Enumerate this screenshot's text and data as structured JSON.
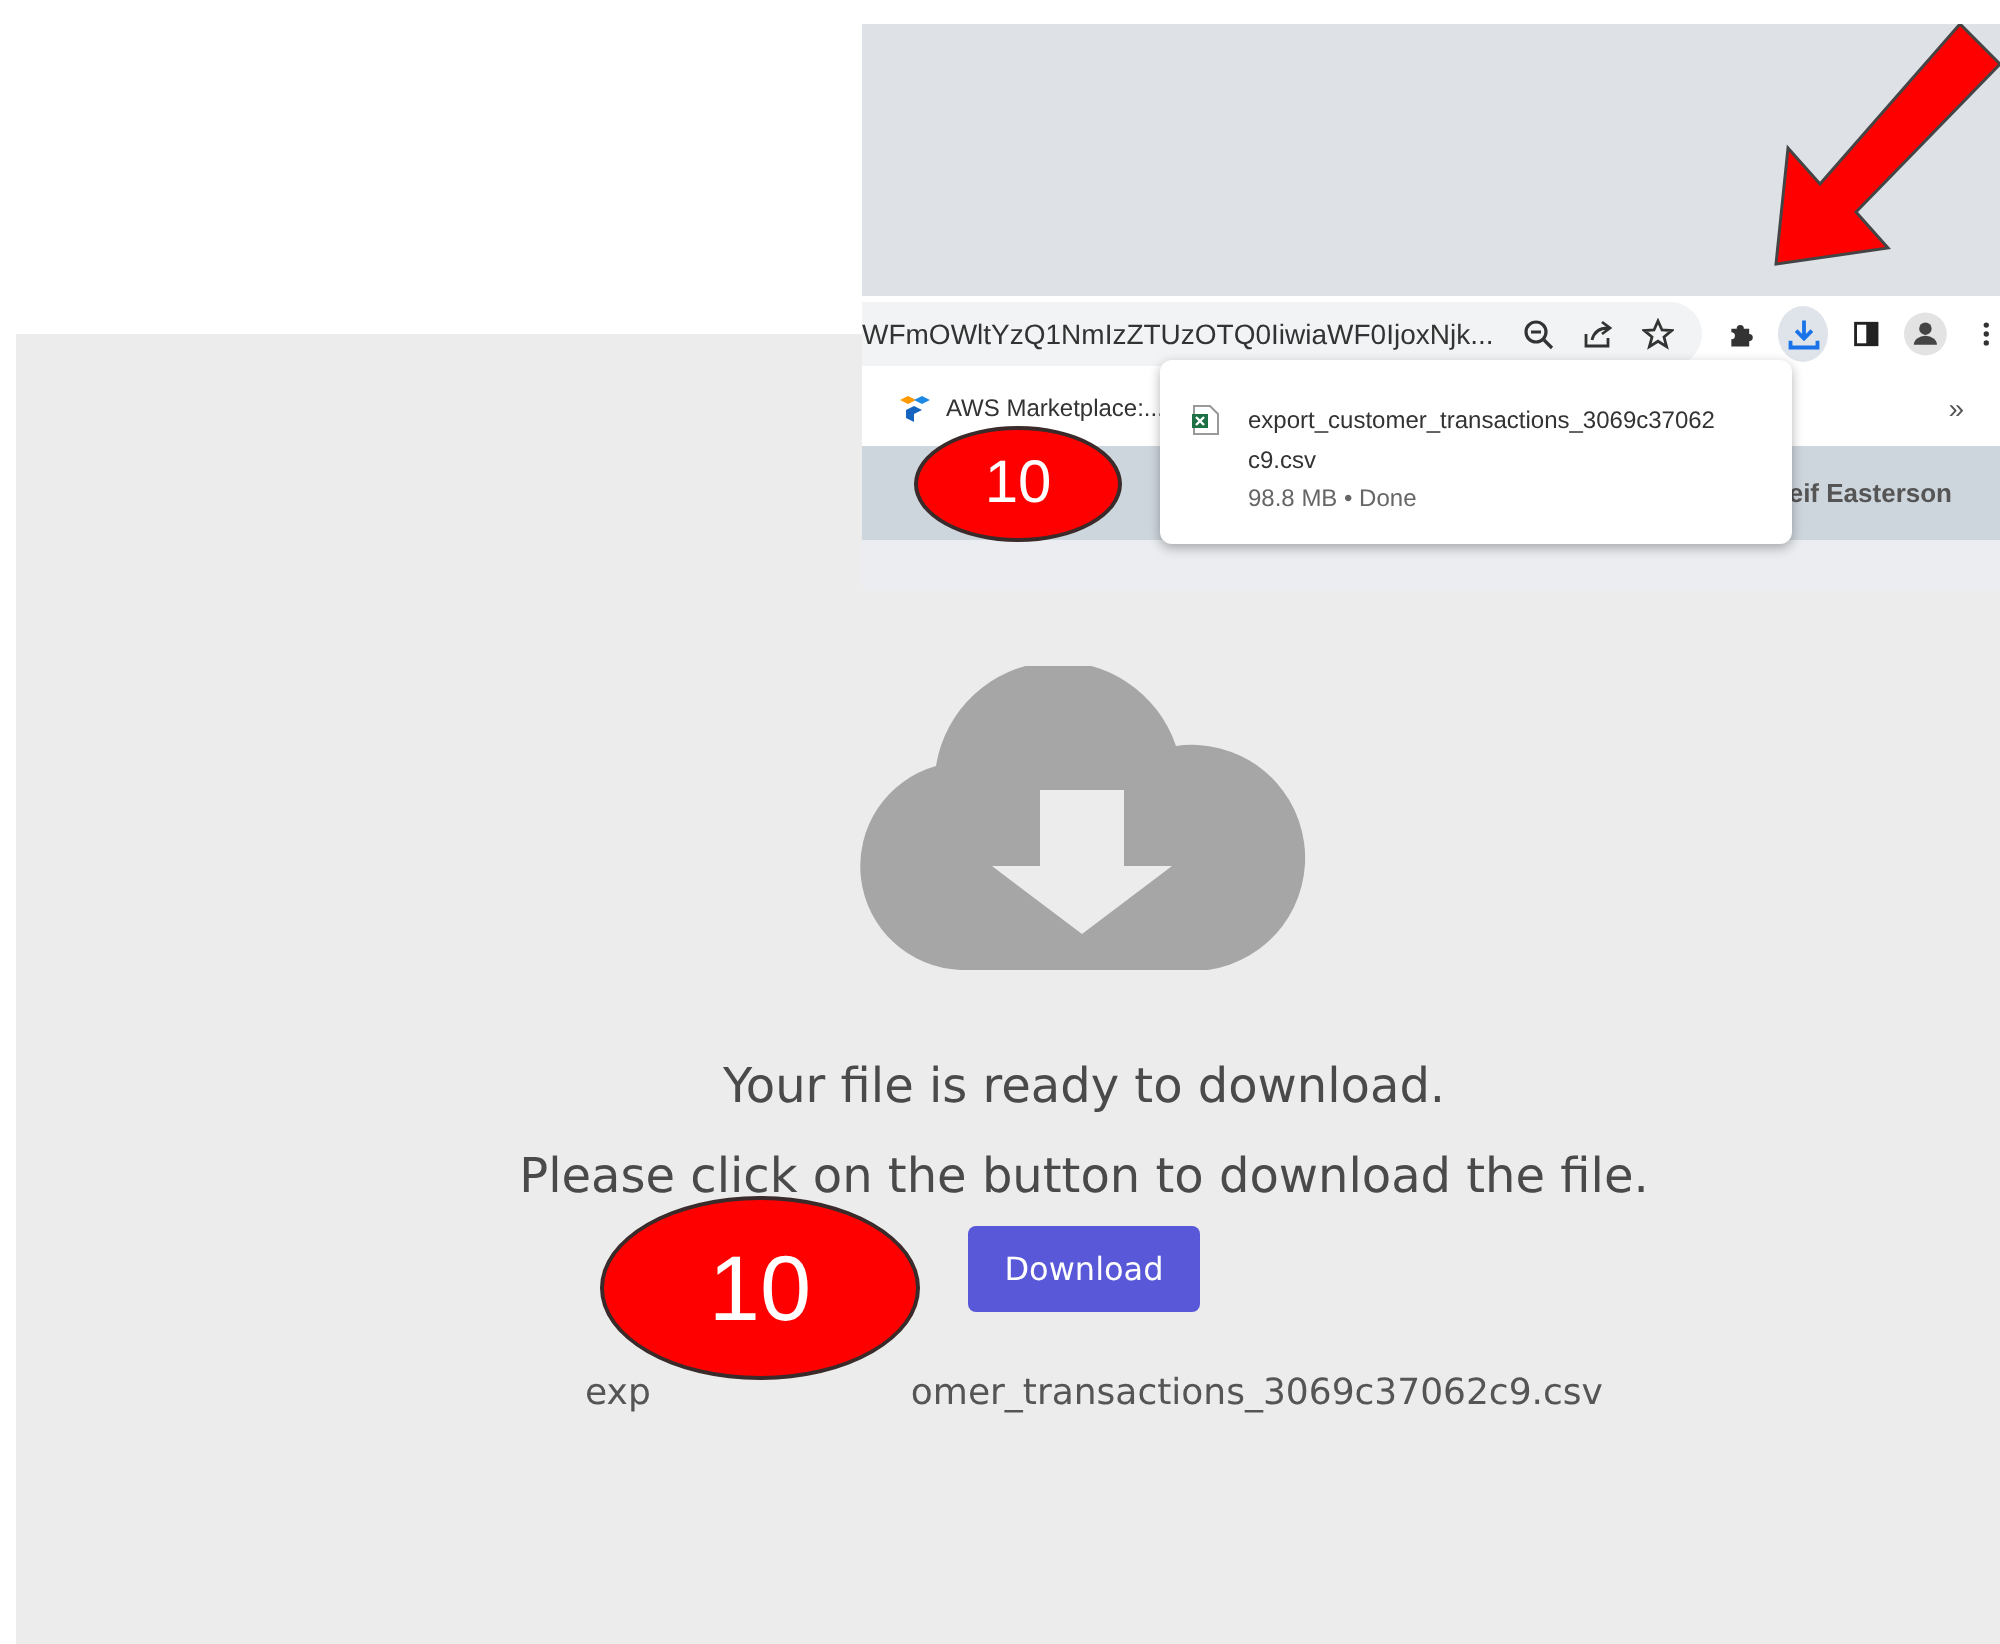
{
  "browser": {
    "address": "WFmOWltYzQ1NmIzZTUzOTQ0IiwiaWF0IjoxNjk...",
    "downloads_active": true,
    "bookmarks": [
      {
        "label": "AWS Marketplace:..."
      }
    ],
    "bookmarks_more": "»",
    "download_popup": {
      "file_name": "export_customer_transactions_3069c37062c9.csv",
      "status": "98.8 MB • Done"
    },
    "header_user": "eif Easterson"
  },
  "page": {
    "lines": [
      "Your file is ready to download.",
      "Please click on the button to download the file."
    ],
    "button": "Download",
    "file_name_parts": [
      "exp",
      "omer_transactions_3069c37062c9.csv"
    ]
  },
  "annotations": {
    "badges": [
      "10",
      "10"
    ]
  }
}
